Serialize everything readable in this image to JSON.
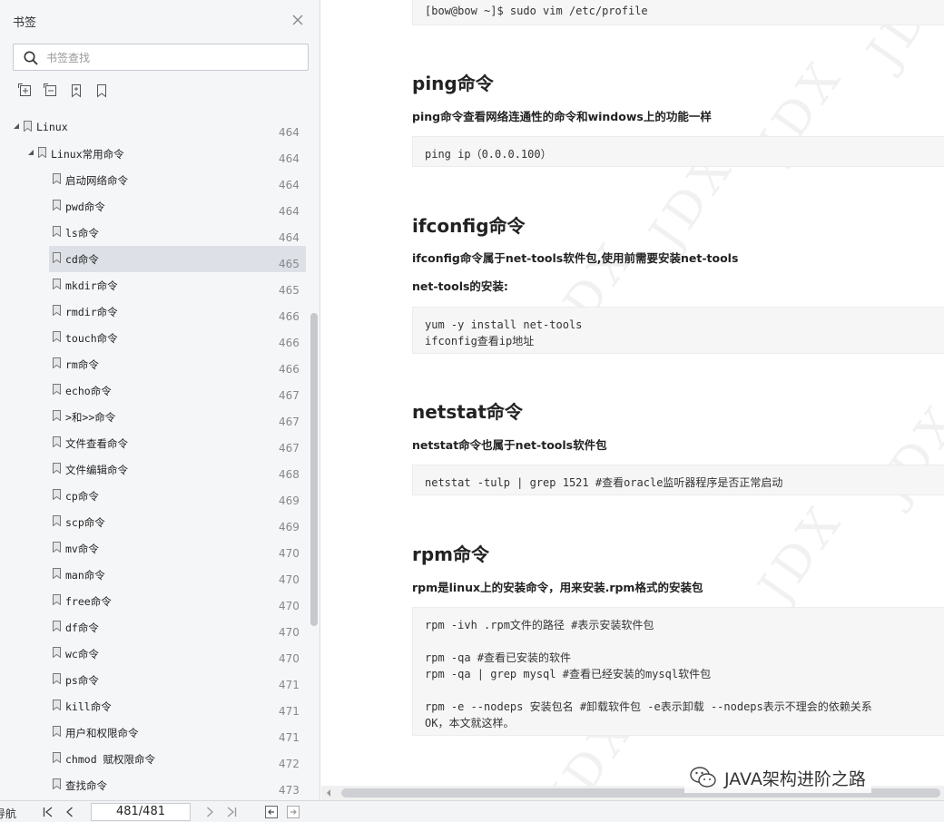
{
  "sidebar": {
    "title": "书签",
    "search_placeholder": "书签查找",
    "items": [
      {
        "label": "Linux",
        "page": "464",
        "level": 0,
        "expanded": true
      },
      {
        "label": "Linux常用命令",
        "page": "464",
        "level": 1,
        "expanded": true
      },
      {
        "label": "启动网络命令",
        "page": "464",
        "level": 2
      },
      {
        "label": "pwd命令",
        "page": "464",
        "level": 2
      },
      {
        "label": "ls命令",
        "page": "464",
        "level": 2
      },
      {
        "label": "cd命令",
        "page": "465",
        "level": 2,
        "selected": true
      },
      {
        "label": "mkdir命令",
        "page": "465",
        "level": 2
      },
      {
        "label": "rmdir命令",
        "page": "466",
        "level": 2
      },
      {
        "label": "touch命令",
        "page": "466",
        "level": 2
      },
      {
        "label": "rm命令",
        "page": "466",
        "level": 2
      },
      {
        "label": "echo命令",
        "page": "467",
        "level": 2
      },
      {
        "label": ">和>>命令",
        "page": "467",
        "level": 2
      },
      {
        "label": "文件查看命令",
        "page": "467",
        "level": 2
      },
      {
        "label": "文件编辑命令",
        "page": "468",
        "level": 2
      },
      {
        "label": "cp命令",
        "page": "469",
        "level": 2
      },
      {
        "label": "scp命令",
        "page": "469",
        "level": 2
      },
      {
        "label": "mv命令",
        "page": "470",
        "level": 2
      },
      {
        "label": "man命令",
        "page": "470",
        "level": 2
      },
      {
        "label": "free命令",
        "page": "470",
        "level": 2
      },
      {
        "label": "df命令",
        "page": "470",
        "level": 2
      },
      {
        "label": "wc命令",
        "page": "470",
        "level": 2
      },
      {
        "label": "ps命令",
        "page": "471",
        "level": 2
      },
      {
        "label": "kill命令",
        "page": "471",
        "level": 2
      },
      {
        "label": "用户和权限命令",
        "page": "471",
        "level": 2
      },
      {
        "label": "chmod 赋权限命令",
        "page": "472",
        "level": 2
      },
      {
        "label": "查找命令",
        "page": "473",
        "level": 2
      }
    ]
  },
  "document": {
    "code_top": "[bow@bow ~]$ sudo vim /etc/profile",
    "ping": {
      "heading": "ping命令",
      "desc": "ping命令查看网络连通性的命令和windows上的功能一样",
      "code": "ping ip（0.0.0.100）"
    },
    "ifconfig": {
      "heading": "ifconfig命令",
      "desc": "ifconfig命令属于net-tools软件包,使用前需要安装net-tools",
      "desc2": "net-tools的安装:",
      "code": "yum -y install net-tools\nifconfig查看ip地址"
    },
    "netstat": {
      "heading": "netstat命令",
      "desc": "netstat命令也属于net-tools软件包",
      "code": "netstat -tulp | grep 1521 #查看oracle监听器程序是否正常启动"
    },
    "rpm": {
      "heading": "rpm命令",
      "desc": "rpm是linux上的安装命令，用来安装.rpm格式的安装包",
      "code": "rpm -ivh .rpm文件的路径 #表示安装软件包\n\nrpm -qa #查看已安装的软件\nrpm -qa | grep mysql #查看已经安装的mysql软件包\n\nrpm -e --nodeps 安装包名 #卸载软件包 -e表示卸载 --nodeps表示不理会的依赖关系\nOK，本文就这样。"
    },
    "watermark": "JDX",
    "brand": "JAVA架构进阶之路"
  },
  "bottombar": {
    "nav_label": "导航",
    "page_display": "481/481"
  },
  "colors": {
    "sidebar_bg": "#f5f6f8",
    "selected_bg": "#dde1e7",
    "code_bg": "#f6f6f6"
  }
}
